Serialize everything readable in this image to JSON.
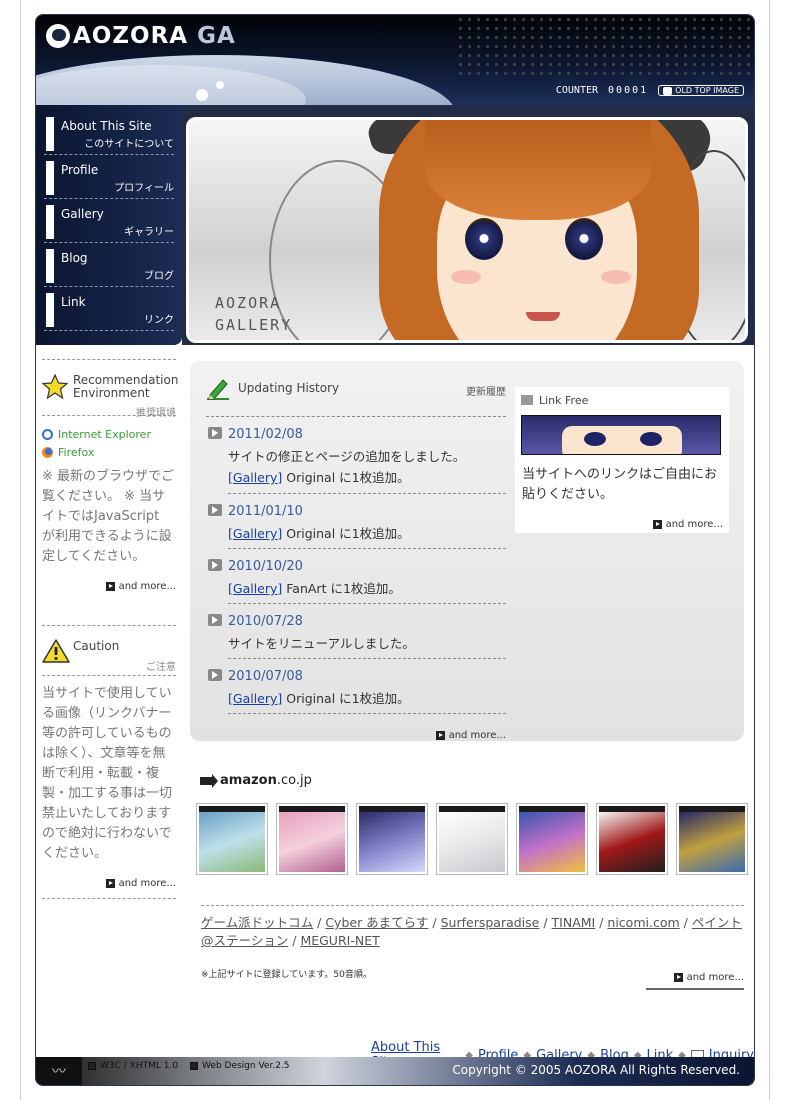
{
  "header": {
    "logo_text": "AOZORA",
    "logo_suffix": "GA",
    "counter_label": "COUNTER",
    "counter_value": "00001",
    "old_top_image": "OLD TOP IMAGE"
  },
  "nav": [
    {
      "en": "About This Site",
      "jp": "このサイトについて"
    },
    {
      "en": "Profile",
      "jp": "プロフィール"
    },
    {
      "en": "Gallery",
      "jp": "ギャラリー"
    },
    {
      "en": "Blog",
      "jp": "ブログ"
    },
    {
      "en": "Link",
      "jp": "リンク"
    }
  ],
  "hero": {
    "line1": "AOZORA",
    "line2": "GALLERY"
  },
  "recommend": {
    "title1": "Recommendation",
    "title2": "Environment",
    "jp": "推奨環境",
    "browsers": [
      "Internet Explorer",
      "Firefox"
    ],
    "text": "※ 最新のブラウザでご覧ください。 ※ 当サイトではJavaScript が利用できるように設定してください。",
    "more": "and more..."
  },
  "caution": {
    "title": "Caution",
    "jp": "ご注意",
    "text": "当サイトで使用している画像（リンクバナー等の許可しているものは除く）、文章等を無断で利用・転載・複製・加工する事は一切禁止いたしておりますので絶対に行わないでください。",
    "more": "and more..."
  },
  "updates": {
    "title": "Updating History",
    "jp": "更新履歴",
    "entries": [
      {
        "date": "2011/02/08",
        "line1": "サイトの修正とページの追加をしました。",
        "link": "[Gallery]",
        "line2": " Original に1枚追加。"
      },
      {
        "date": "2011/01/10",
        "link": "[Gallery]",
        "line1": " Original に1枚追加。"
      },
      {
        "date": "2010/10/20",
        "link": "[Gallery]",
        "line1": " FanArt に1枚追加。"
      },
      {
        "date": "2010/07/28",
        "line1": "サイトをリニューアルしました。"
      },
      {
        "date": "2010/07/08",
        "link": "[Gallery]",
        "line1": " Original に1枚追加。"
      }
    ],
    "more": "and more..."
  },
  "linkfree": {
    "title": "Link Free",
    "text": "当サイトへのリンクはご自由にお貼りください。",
    "more": "and more..."
  },
  "amazon": {
    "label_bold": "amazon",
    "label_rest": ".co.jp"
  },
  "covers": [
    {
      "name": "cover-1",
      "colors": [
        "#6aa0c8",
        "#bfe0ea",
        "#8cb878"
      ]
    },
    {
      "name": "cover-2",
      "colors": [
        "#e7a0c0",
        "#f4d0dc",
        "#b06090"
      ]
    },
    {
      "name": "cover-3",
      "colors": [
        "#2c2c6a",
        "#8080c8",
        "#d8d8ff"
      ]
    },
    {
      "name": "cover-4",
      "colors": [
        "#ffffff",
        "#e8e8e8",
        "#c8c8d0"
      ]
    },
    {
      "name": "cover-5",
      "colors": [
        "#3a56b0",
        "#c070c8",
        "#f0c040"
      ]
    },
    {
      "name": "cover-6",
      "colors": [
        "#f4f4f4",
        "#a01818",
        "#202020"
      ]
    },
    {
      "name": "cover-7",
      "colors": [
        "#282868",
        "#c0a040",
        "#3a6ab0"
      ]
    }
  ],
  "sites": [
    "ゲーム派ドットコム",
    "Cyber あまてらす",
    "Surfersparadise",
    "TINAMI",
    "nicomi.com",
    "ペイント@ステーション",
    "MEGURI-NET"
  ],
  "sites_note": "※上記サイトに登録しています。50音順。",
  "sites_more": "and more...",
  "footer_nav": [
    "About This Site",
    "Profile",
    "Gallery",
    "Blog",
    "Link",
    "Inquiry"
  ],
  "badges": [
    "W3C / XHTML 1.0",
    "Web Design Ver.2.5"
  ],
  "copyright": "Copyright © 2005 AOZORA All Rights Reserved."
}
